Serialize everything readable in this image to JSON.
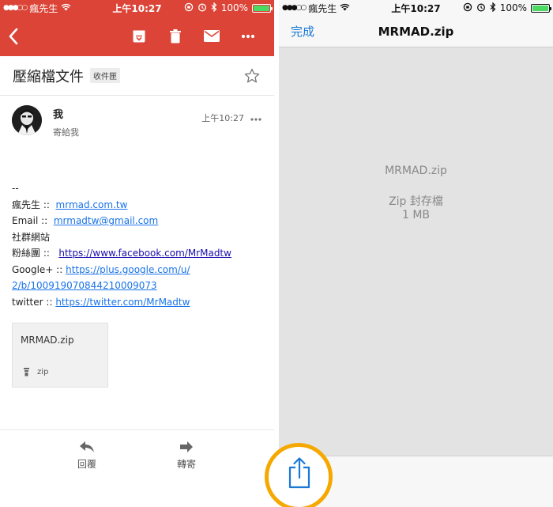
{
  "left_status": {
    "carrier": "瘋先生",
    "time": "上午10:27",
    "battery": "100%",
    "battery_level": 1.0,
    "battery_color": "#4cd964"
  },
  "gmail": {
    "accent": "#db4437",
    "toolbar_icons": [
      "back-arrow-icon",
      "archive-icon",
      "trash-icon",
      "mail-icon",
      "more-icon"
    ],
    "subject": "壓縮檔文件",
    "label": "收件匣",
    "sender": {
      "name": "我",
      "to": "寄給我",
      "time": "上午10:27"
    },
    "signature": {
      "dash": "--",
      "lines": [
        {
          "label": "瘋先生 ::",
          "link": "mrmad.com.tw"
        },
        {
          "label": "Email  ::",
          "link": "mrmadtw@gmail.com"
        },
        {
          "label": "社群網站",
          "link": ""
        },
        {
          "label": "粉絲團   ::",
          "link": "https://www.facebook.com/MrMadtw"
        },
        {
          "label": "Google+  ::",
          "link": "https://plus.google.com/u/"
        },
        {
          "label": "",
          "link": "2/b/100919070844210009073"
        },
        {
          "label": "twitter ::",
          "link": "https://twitter.com/MrMadtw"
        }
      ]
    },
    "attachment": {
      "name": "MRMAD.zip",
      "type": "zip"
    },
    "bottom": {
      "reply": "回覆",
      "forward": "轉寄"
    }
  },
  "right_status": {
    "carrier": "瘋先生",
    "time": "上午10:27",
    "battery": "100%",
    "battery_level": 1.0,
    "battery_color": "#4cd964"
  },
  "preview": {
    "done": "完成",
    "title": "MRMAD.zip",
    "file_name": "MRMAD.zip",
    "file_type": "Zip 封存檔",
    "file_size": "1 MB",
    "tint": "#1a78d6",
    "highlight_color": "#f5a800"
  }
}
